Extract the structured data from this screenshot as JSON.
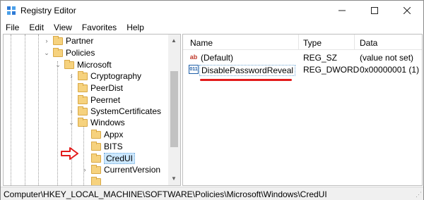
{
  "window": {
    "title": "Registry Editor"
  },
  "menu": [
    "File",
    "Edit",
    "View",
    "Favorites",
    "Help"
  ],
  "tree": [
    {
      "label": "Partner",
      "chevron": "right"
    },
    {
      "label": "Policies",
      "chevron": "down"
    },
    {
      "label": "Microsoft",
      "chevron": "down"
    },
    {
      "label": "Cryptography",
      "chevron": "right"
    },
    {
      "label": "PeerDist",
      "chevron": ""
    },
    {
      "label": "Peernet",
      "chevron": ""
    },
    {
      "label": "SystemCertificates",
      "chevron": "right"
    },
    {
      "label": "Windows",
      "chevron": "down"
    },
    {
      "label": "Appx",
      "chevron": ""
    },
    {
      "label": "BITS",
      "chevron": ""
    },
    {
      "label": "CredUI",
      "chevron": "",
      "selected": true
    },
    {
      "label": "CurrentVersion",
      "chevron": "right"
    }
  ],
  "list": {
    "columns": [
      "Name",
      "Type",
      "Data"
    ],
    "rows": [
      {
        "icon": "string-value-icon",
        "name": "(Default)",
        "type": "REG_SZ",
        "data": "(value not set)"
      },
      {
        "icon": "dword-value-icon",
        "name": "DisablePasswordReveal",
        "type": "REG_DWORD",
        "data": "0x00000001 (1)"
      }
    ]
  },
  "status": {
    "path": "Computer\\HKEY_LOCAL_MACHINE\\SOFTWARE\\Policies\\Microsoft\\Windows\\CredUI"
  },
  "colors": {
    "annotation_red": "#e31b1b",
    "selection_blue": "#cce8ff",
    "folder_yellow": "#f6d27e"
  }
}
